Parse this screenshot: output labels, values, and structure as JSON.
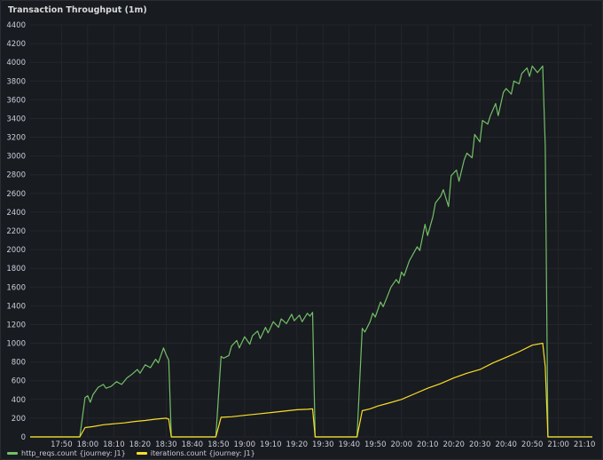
{
  "panel": {
    "title": "Transaction Throughput (1m)"
  },
  "chart_data": {
    "type": "line",
    "title": "Transaction Throughput (1m)",
    "xlabel": "",
    "ylabel": "",
    "ylim": [
      0,
      4400
    ],
    "y_ticks": [
      0,
      200,
      400,
      600,
      800,
      1000,
      1200,
      1400,
      1600,
      1800,
      2000,
      2200,
      2400,
      2600,
      2800,
      3000,
      3200,
      3400,
      3600,
      3800,
      4000,
      4200,
      4400
    ],
    "x_range": [
      "17:38",
      "21:13"
    ],
    "x_ticks": [
      "17:50",
      "18:00",
      "18:10",
      "18:20",
      "18:30",
      "18:40",
      "18:50",
      "19:00",
      "19:10",
      "19:20",
      "19:30",
      "19:40",
      "19:50",
      "20:00",
      "20:10",
      "20:20",
      "20:30",
      "20:40",
      "20:50",
      "21:00",
      "21:10"
    ],
    "grid": true,
    "legend_position": "bottom-left",
    "series": [
      {
        "name": "http_reqs.count {journey: J1}",
        "color": "#73bf69",
        "points": [
          [
            "17:38",
            0
          ],
          [
            "17:57",
            0
          ],
          [
            "17:59",
            420
          ],
          [
            "18:00",
            440
          ],
          [
            "18:01",
            370
          ],
          [
            "18:02",
            450
          ],
          [
            "18:04",
            530
          ],
          [
            "18:06",
            560
          ],
          [
            "18:07",
            520
          ],
          [
            "18:09",
            540
          ],
          [
            "18:11",
            590
          ],
          [
            "18:13",
            560
          ],
          [
            "18:15",
            630
          ],
          [
            "18:17",
            670
          ],
          [
            "18:19",
            720
          ],
          [
            "18:20",
            680
          ],
          [
            "18:22",
            770
          ],
          [
            "18:24",
            740
          ],
          [
            "18:26",
            830
          ],
          [
            "18:27",
            790
          ],
          [
            "18:29",
            950
          ],
          [
            "18:30",
            880
          ],
          [
            "18:31",
            820
          ],
          [
            "18:32",
            0
          ],
          [
            "18:49",
            0
          ],
          [
            "18:51",
            860
          ],
          [
            "18:52",
            840
          ],
          [
            "18:54",
            870
          ],
          [
            "18:55",
            970
          ],
          [
            "18:57",
            1030
          ],
          [
            "18:58",
            950
          ],
          [
            "19:00",
            1070
          ],
          [
            "19:02",
            990
          ],
          [
            "19:03",
            1080
          ],
          [
            "19:05",
            1130
          ],
          [
            "19:06",
            1050
          ],
          [
            "19:08",
            1170
          ],
          [
            "19:09",
            1110
          ],
          [
            "19:11",
            1230
          ],
          [
            "19:13",
            1170
          ],
          [
            "19:14",
            1260
          ],
          [
            "19:16",
            1210
          ],
          [
            "19:18",
            1310
          ],
          [
            "19:19",
            1240
          ],
          [
            "19:21",
            1300
          ],
          [
            "19:22",
            1230
          ],
          [
            "19:24",
            1320
          ],
          [
            "19:25",
            1290
          ],
          [
            "19:26",
            1330
          ],
          [
            "19:27",
            0
          ],
          [
            "19:43",
            0
          ],
          [
            "19:45",
            1160
          ],
          [
            "19:46",
            1120
          ],
          [
            "19:48",
            1230
          ],
          [
            "19:49",
            1320
          ],
          [
            "19:50",
            1280
          ],
          [
            "19:52",
            1440
          ],
          [
            "19:53",
            1390
          ],
          [
            "19:55",
            1530
          ],
          [
            "19:56",
            1600
          ],
          [
            "19:58",
            1680
          ],
          [
            "19:59",
            1640
          ],
          [
            "20:00",
            1760
          ],
          [
            "20:01",
            1720
          ],
          [
            "20:03",
            1880
          ],
          [
            "20:04",
            1930
          ],
          [
            "20:06",
            2030
          ],
          [
            "20:07",
            1990
          ],
          [
            "20:09",
            2270
          ],
          [
            "20:10",
            2150
          ],
          [
            "20:12",
            2350
          ],
          [
            "20:13",
            2500
          ],
          [
            "20:15",
            2570
          ],
          [
            "20:16",
            2640
          ],
          [
            "20:18",
            2460
          ],
          [
            "20:19",
            2790
          ],
          [
            "20:21",
            2850
          ],
          [
            "20:22",
            2730
          ],
          [
            "20:24",
            2960
          ],
          [
            "20:25",
            3030
          ],
          [
            "20:27",
            2980
          ],
          [
            "20:28",
            3230
          ],
          [
            "20:30",
            3150
          ],
          [
            "20:31",
            3380
          ],
          [
            "20:33",
            3340
          ],
          [
            "20:34",
            3430
          ],
          [
            "20:36",
            3560
          ],
          [
            "20:37",
            3430
          ],
          [
            "20:39",
            3680
          ],
          [
            "20:40",
            3720
          ],
          [
            "20:42",
            3660
          ],
          [
            "20:43",
            3800
          ],
          [
            "20:45",
            3770
          ],
          [
            "20:46",
            3880
          ],
          [
            "20:48",
            3940
          ],
          [
            "20:49",
            3850
          ],
          [
            "20:50",
            3960
          ],
          [
            "20:52",
            3890
          ],
          [
            "20:54",
            3960
          ],
          [
            "20:55",
            3100
          ],
          [
            "20:56",
            0
          ],
          [
            "21:13",
            0
          ]
        ]
      },
      {
        "name": "iterations.count {journey: J1}",
        "color": "#fade2a",
        "points": [
          [
            "17:38",
            0
          ],
          [
            "17:57",
            0
          ],
          [
            "17:59",
            100
          ],
          [
            "18:02",
            110
          ],
          [
            "18:06",
            130
          ],
          [
            "18:10",
            140
          ],
          [
            "18:14",
            150
          ],
          [
            "18:18",
            165
          ],
          [
            "18:22",
            175
          ],
          [
            "18:26",
            190
          ],
          [
            "18:30",
            200
          ],
          [
            "18:31",
            190
          ],
          [
            "18:32",
            0
          ],
          [
            "18:49",
            0
          ],
          [
            "18:51",
            210
          ],
          [
            "18:55",
            215
          ],
          [
            "19:00",
            230
          ],
          [
            "19:05",
            245
          ],
          [
            "19:10",
            260
          ],
          [
            "19:15",
            275
          ],
          [
            "19:20",
            290
          ],
          [
            "19:24",
            295
          ],
          [
            "19:26",
            300
          ],
          [
            "19:27",
            0
          ],
          [
            "19:43",
            0
          ],
          [
            "19:45",
            280
          ],
          [
            "19:48",
            300
          ],
          [
            "19:51",
            330
          ],
          [
            "19:55",
            360
          ],
          [
            "20:00",
            400
          ],
          [
            "20:05",
            460
          ],
          [
            "20:10",
            520
          ],
          [
            "20:15",
            570
          ],
          [
            "20:20",
            630
          ],
          [
            "20:25",
            680
          ],
          [
            "20:30",
            720
          ],
          [
            "20:35",
            790
          ],
          [
            "20:40",
            850
          ],
          [
            "20:45",
            910
          ],
          [
            "20:50",
            980
          ],
          [
            "20:54",
            1000
          ],
          [
            "20:55",
            750
          ],
          [
            "20:56",
            0
          ],
          [
            "21:13",
            0
          ]
        ]
      }
    ]
  }
}
